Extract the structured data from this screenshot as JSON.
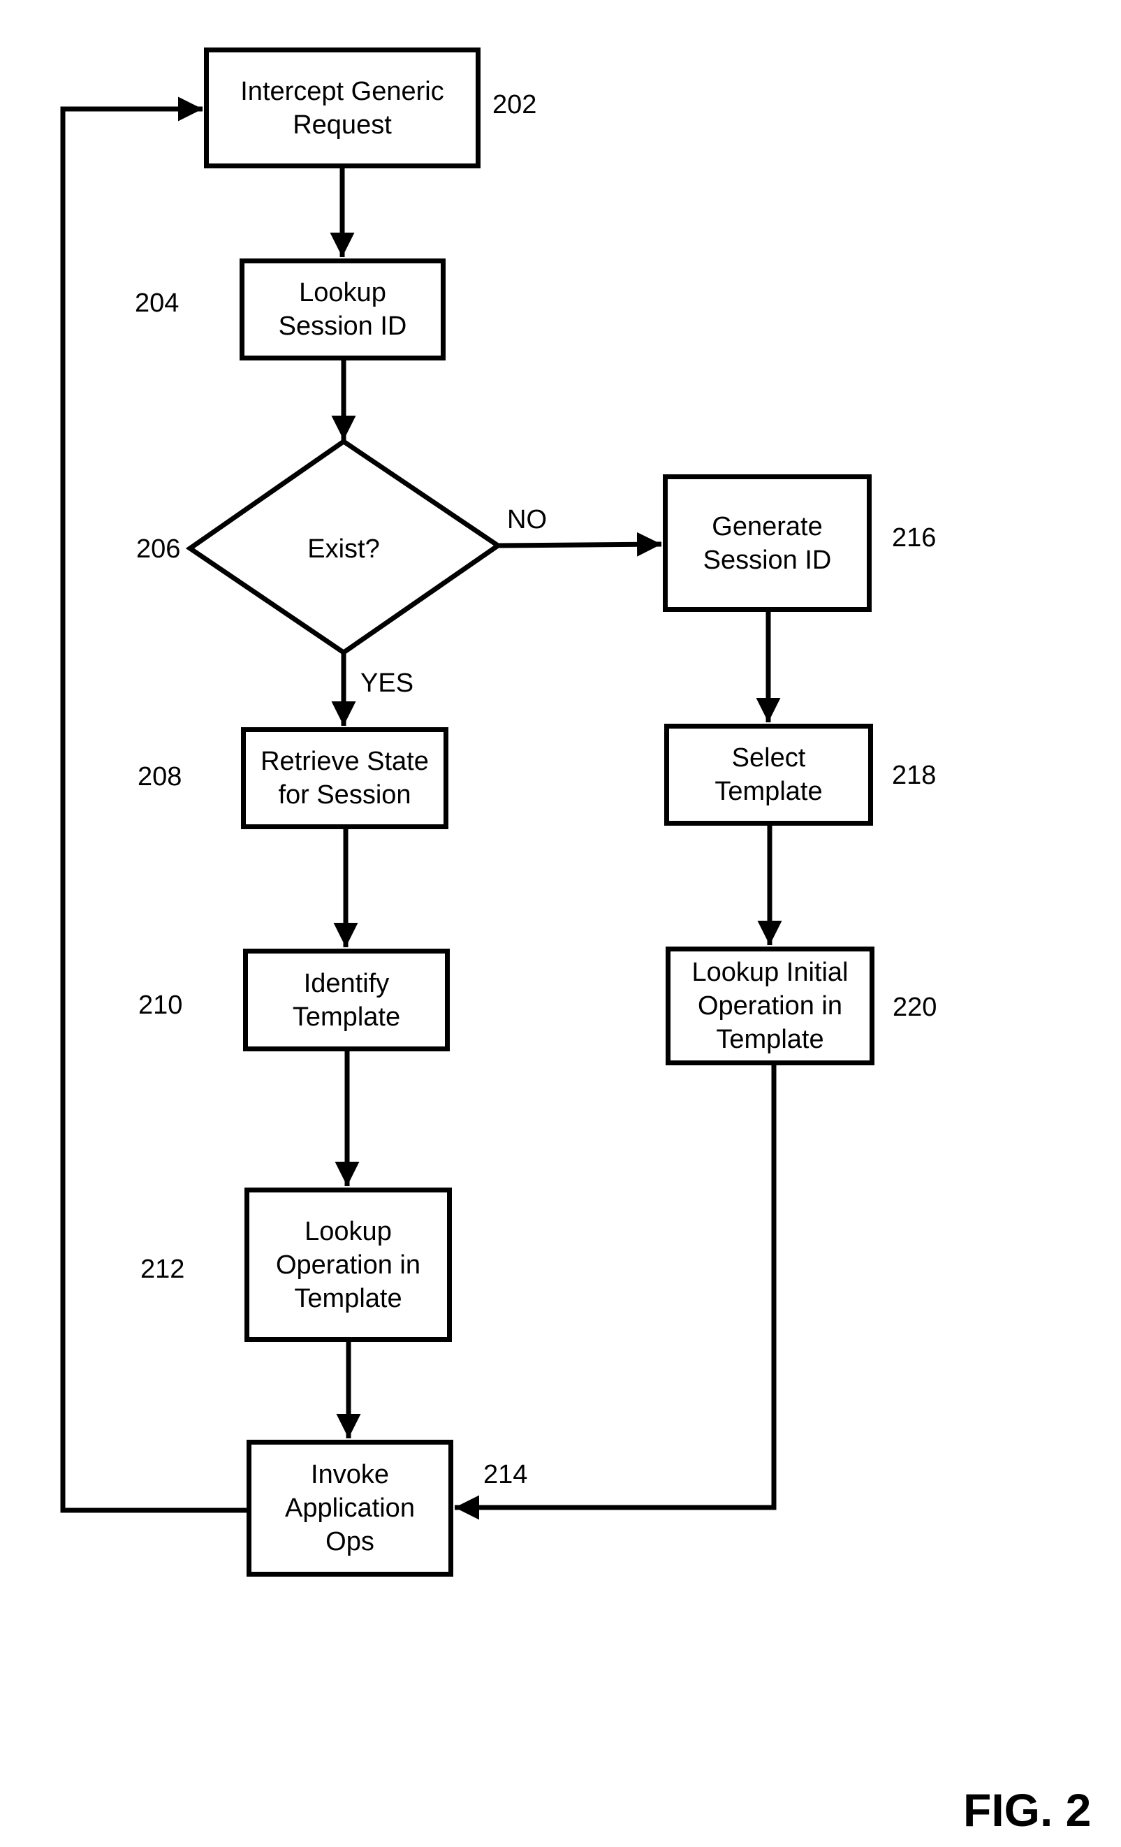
{
  "figure_label": "FIG. 2",
  "nodes": {
    "n202": {
      "ref": "202",
      "text": "Intercept Generic\nRequest"
    },
    "n204": {
      "ref": "204",
      "text": "Lookup\nSession ID"
    },
    "n206": {
      "ref": "206",
      "text": "Exist?"
    },
    "n208": {
      "ref": "208",
      "text": "Retrieve State\nfor Session"
    },
    "n210": {
      "ref": "210",
      "text": "Identify\nTemplate"
    },
    "n212": {
      "ref": "212",
      "text": "Lookup\nOperation in\nTemplate"
    },
    "n214": {
      "ref": "214",
      "text": "Invoke\nApplication\nOps"
    },
    "n216": {
      "ref": "216",
      "text": "Generate\nSession ID"
    },
    "n218": {
      "ref": "218",
      "text": "Select\nTemplate"
    },
    "n220": {
      "ref": "220",
      "text": "Lookup Initial\nOperation in\nTemplate"
    }
  },
  "branches": {
    "no": "NO",
    "yes": "YES"
  },
  "edges": [
    {
      "from": "202",
      "to": "204"
    },
    {
      "from": "204",
      "to": "206"
    },
    {
      "from": "206",
      "to": "216",
      "label": "NO"
    },
    {
      "from": "206",
      "to": "208",
      "label": "YES"
    },
    {
      "from": "208",
      "to": "210"
    },
    {
      "from": "210",
      "to": "212"
    },
    {
      "from": "212",
      "to": "214"
    },
    {
      "from": "216",
      "to": "218"
    },
    {
      "from": "218",
      "to": "220"
    },
    {
      "from": "220",
      "to": "214"
    },
    {
      "from": "214",
      "to": "202"
    }
  ]
}
